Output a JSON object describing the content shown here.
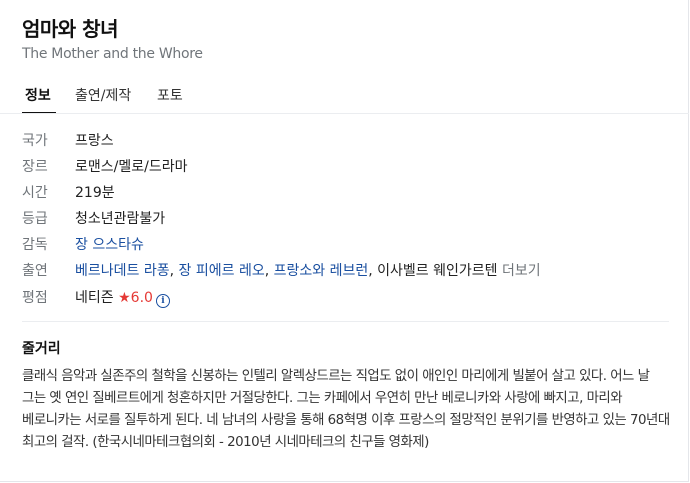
{
  "title": "엄마와 창녀",
  "subtitle": "The Mother and the Whore",
  "tabs": [
    {
      "label": "정보",
      "active": true
    },
    {
      "label": "출연/제작",
      "active": false
    },
    {
      "label": "포토",
      "active": false
    }
  ],
  "info": {
    "country": {
      "label": "국가",
      "value": "프랑스"
    },
    "genre": {
      "label": "장르",
      "value": "로맨스/멜로/드라마"
    },
    "runtime": {
      "label": "시간",
      "value": "219분"
    },
    "rating_class": {
      "label": "등급",
      "value": "청소년관람불가"
    },
    "director": {
      "label": "감독",
      "value": "장 으스타슈"
    },
    "cast": {
      "label": "출연",
      "actors": [
        "베르나데트 라퐁",
        "장 피에르 레오",
        "프랑소와 레브런",
        "이사벨르 웨인가르텐"
      ],
      "separator": ", ",
      "more": "더보기"
    },
    "score": {
      "label": "평점",
      "source": "네티즌",
      "star": "★",
      "value": "6.0",
      "info_glyph": "i"
    }
  },
  "synopsis": {
    "heading": "줄거리",
    "text": "클래식 음악과 실존주의 철학을 신봉하는 인텔리 알렉상드르는 직업도 없이 애인인 마리에게 빌붙어 살고 있다. 어느 날 그는 옛 연인 질베르트에게 청혼하지만 거절당한다. 그는 카페에서 우연히 만난 베로니카와 사랑에 빠지고, 마리와 베로니카는 서로를 질투하게 된다. 네 남녀의 사랑을 통해 68혁명 이후 프랑스의 절망적인 분위기를 반영하고 있는 70년대 최고의 걸작. (한국시네마테크협의회 - 2010년 시네마테크의 친구들 영화제)"
  },
  "colors": {
    "link": "#1a4fa0",
    "rating": "#e53935",
    "label": "#70757a"
  }
}
